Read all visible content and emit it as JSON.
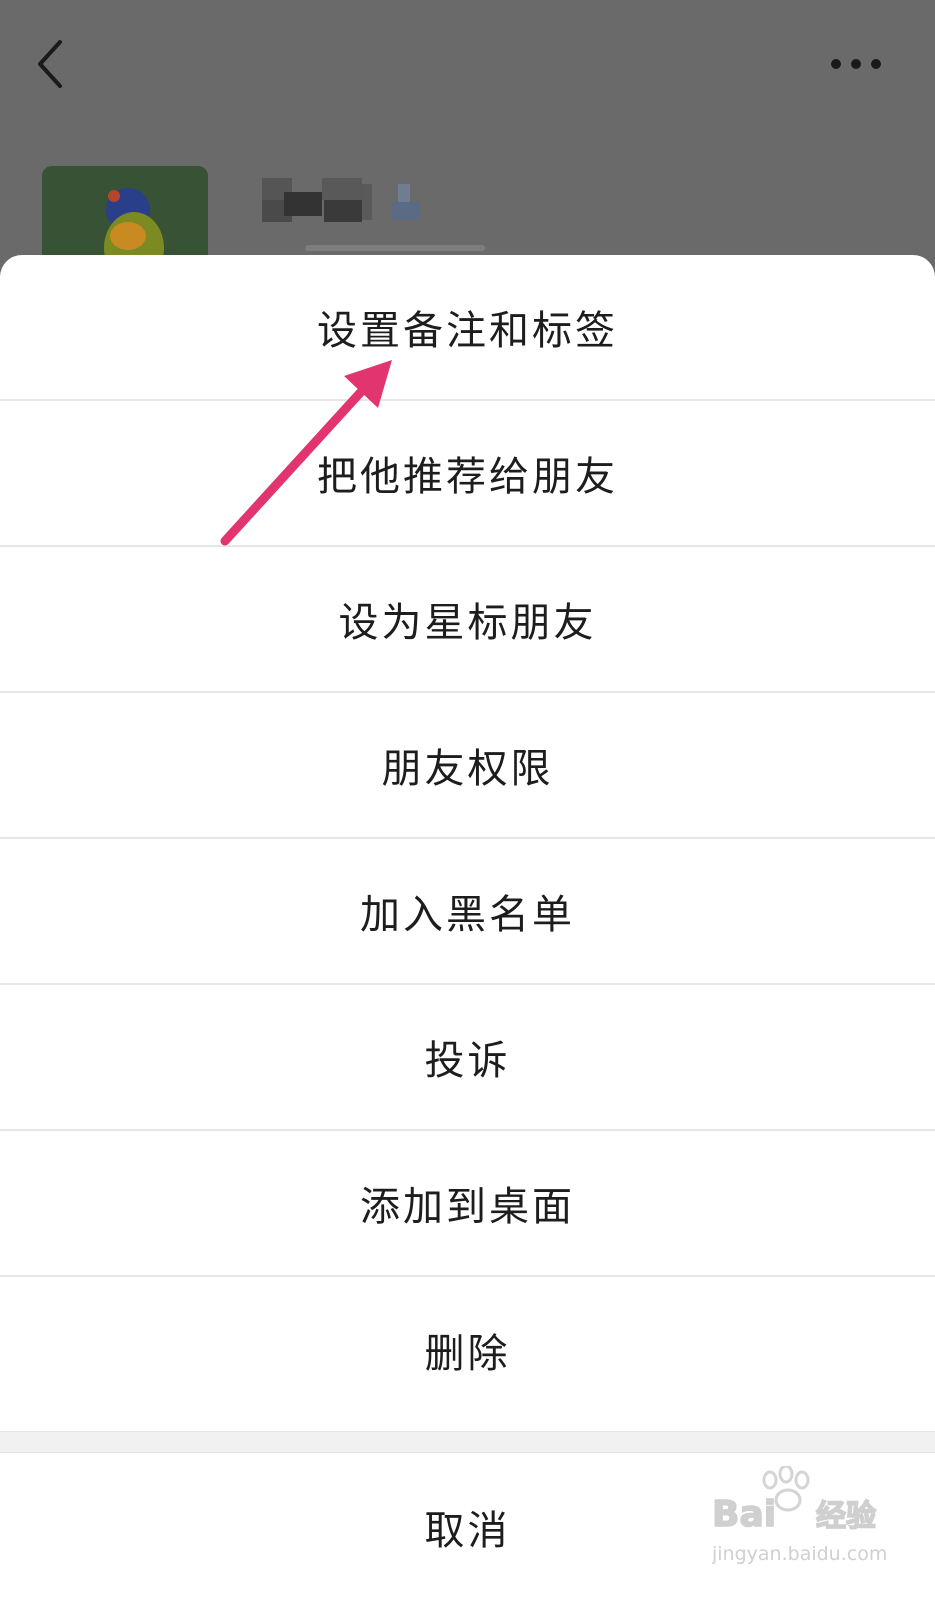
{
  "menu": {
    "items": [
      {
        "label": "设置备注和标签"
      },
      {
        "label": "把他推荐给朋友"
      },
      {
        "label": "设为星标朋友"
      },
      {
        "label": "朋友权限"
      },
      {
        "label": "加入黑名单"
      },
      {
        "label": "投诉"
      },
      {
        "label": "添加到桌面"
      },
      {
        "label": "删除"
      }
    ],
    "cancel_label": "取消"
  },
  "watermark": {
    "brand": "Bai",
    "brand2": "经验",
    "url": "jingyan.baidu.com"
  },
  "icons": {
    "back": "back-arrow-icon",
    "more": "more-dots-icon",
    "annotation": "pink-annotation-arrow"
  },
  "colors": {
    "annotation_arrow": "#e2356f",
    "overlay": "#6a6a6a"
  }
}
